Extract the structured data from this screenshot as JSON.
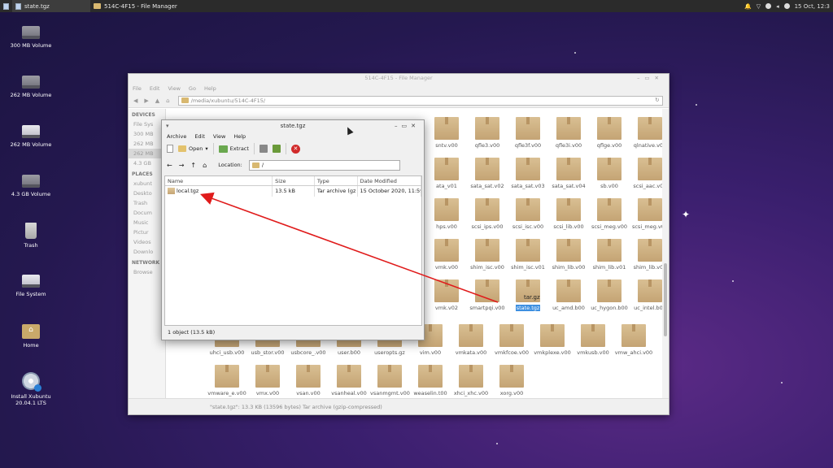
{
  "panel": {
    "tasks": [
      {
        "label": "state.tgz",
        "active": true
      },
      {
        "label": "514C-4F15 - File Manager",
        "active": false
      }
    ],
    "clock": "15 Oct, 12:3"
  },
  "desktop": {
    "icons": [
      {
        "label": "300 MB Volume",
        "icon": "drive-icon"
      },
      {
        "label": "262 MB Volume",
        "icon": "drive-icon"
      },
      {
        "label": "262 MB Volume",
        "icon": "drive-icon"
      },
      {
        "label": "4.3 GB Volume",
        "icon": "drive-icon"
      },
      {
        "label": "Trash",
        "icon": "trash-icon"
      },
      {
        "label": "File System",
        "icon": "drive-icon"
      },
      {
        "label": "Home",
        "icon": "home-folder-icon"
      },
      {
        "label": "Install Xubuntu 20.04.1 LTS",
        "icon": "install-disc-icon"
      }
    ]
  },
  "file_manager": {
    "title": "514C-4F15 - File Manager",
    "menu": [
      "File",
      "Edit",
      "View",
      "Go",
      "Help"
    ],
    "location": "/media/xubuntu/514C-4F15/",
    "sidebar": {
      "devices_heading": "DEVICES",
      "devices": [
        "File Sys",
        "300 MB",
        "262 MB",
        "262 MB",
        "4.3 GB"
      ],
      "places_heading": "PLACES",
      "places": [
        "xubunt",
        "Deskto",
        "Trash",
        "Docum",
        "Music",
        "Pictur",
        "Videos",
        "Downlo"
      ],
      "network_heading": "NETWORK",
      "network": [
        "Browse"
      ]
    },
    "files": [
      {
        "name": "sntv.v00"
      },
      {
        "name": "qfle3.v00"
      },
      {
        "name": "qfle3f.v00"
      },
      {
        "name": "qfle3i.v00"
      },
      {
        "name": "qflge.v00"
      },
      {
        "name": "qlnative.v00"
      },
      {
        "name": "ata_v01"
      },
      {
        "name": "sata_sat.v02"
      },
      {
        "name": "sata_sat.v03"
      },
      {
        "name": "sata_sat.v04"
      },
      {
        "name": "sb.v00"
      },
      {
        "name": "scsi_aac.v00"
      },
      {
        "name": "hps.v00"
      },
      {
        "name": "scsi_ips.v00"
      },
      {
        "name": "scsi_isc.v00"
      },
      {
        "name": "scsi_lib.v00"
      },
      {
        "name": "scsi_meg.v00"
      },
      {
        "name": "scsi_meg.v01"
      },
      {
        "name": "vmk.v00"
      },
      {
        "name": "shim_isc.v00"
      },
      {
        "name": "shim_isc.v01"
      },
      {
        "name": "shim_lib.v00"
      },
      {
        "name": "shim_lib.v01"
      },
      {
        "name": "shim_lib.v02"
      },
      {
        "name": "vmk.v02"
      },
      {
        "name": "smartpqi.v00"
      },
      {
        "name": "state.tgz",
        "selected": true,
        "overlay": "tar.gz"
      },
      {
        "name": "uc_amd.b00"
      },
      {
        "name": "uc_hygon.b00"
      },
      {
        "name": "uc_intel.b00"
      },
      {
        "name": "uhci_usb.v00"
      },
      {
        "name": "usb_stor.v00"
      },
      {
        "name": "usbcore_.v00"
      },
      {
        "name": "user.b00"
      },
      {
        "name": "useropts.gz"
      },
      {
        "name": "vim.v00"
      },
      {
        "name": "vmkata.v00"
      },
      {
        "name": "vmkfcoe.v00"
      },
      {
        "name": "vmkplexe.v00"
      },
      {
        "name": "vmkusb.v00"
      },
      {
        "name": "vmw_ahci.v00"
      },
      {
        "name": "vmware_e.v00"
      },
      {
        "name": "vmx.v00"
      },
      {
        "name": "vsan.v00"
      },
      {
        "name": "vsanheal.v00"
      },
      {
        "name": "vsanmgmt.v00"
      },
      {
        "name": "weaselin.t00"
      },
      {
        "name": "xhci_xhc.v00"
      },
      {
        "name": "xorg.v00"
      }
    ],
    "status": "\"state.tgz\": 13.3 KB (13596 bytes) Tar archive (gzip-compressed)"
  },
  "archive_manager": {
    "title": "state.tgz",
    "menu": [
      "Archive",
      "Edit",
      "View",
      "Help"
    ],
    "toolbar": {
      "open_label": "Open",
      "extract_label": "Extract"
    },
    "location_label": "Location:",
    "location_value": "/",
    "columns": [
      "Name",
      "Size",
      "Type",
      "Date Modified"
    ],
    "rows": [
      {
        "name": "local.tgz",
        "size": "13.5 kB",
        "type": "Tar archive (gz",
        "date": "15 October 2020, 11:59"
      }
    ],
    "status": "1 object (13.5 kB)"
  },
  "annotation": {
    "color": "#e01b1b"
  }
}
